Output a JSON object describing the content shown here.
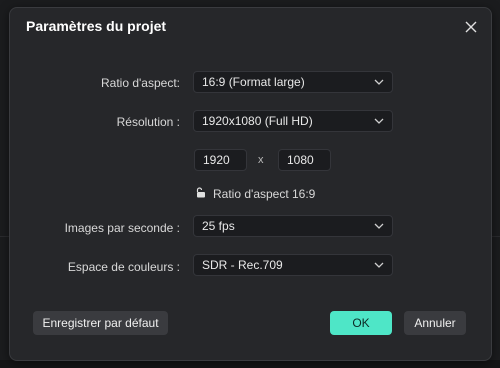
{
  "dialog": {
    "title": "Paramètres du projet"
  },
  "fields": {
    "aspect_ratio": {
      "label": "Ratio d'aspect:",
      "value": "16:9 (Format large)"
    },
    "resolution": {
      "label": "Résolution :",
      "value": "1920x1080 (Full HD)"
    },
    "width": "1920",
    "height": "1080",
    "times_symbol": "x",
    "lock_text": "Ratio d'aspect 16:9",
    "fps": {
      "label": "Images par seconde :",
      "value": "25 fps"
    },
    "color_space": {
      "label": "Espace de couleurs :",
      "value": "SDR - Rec.709"
    }
  },
  "buttons": {
    "set_default": "Enregistrer par défaut",
    "ok": "OK",
    "cancel": "Annuler"
  },
  "icons": {
    "close": "close-icon",
    "chevron": "chevron-down-icon",
    "lock": "lock-open-icon"
  },
  "colors": {
    "accent": "#4ee6c7",
    "dialog_bg": "#26272a",
    "field_bg": "#1b1c1f"
  }
}
